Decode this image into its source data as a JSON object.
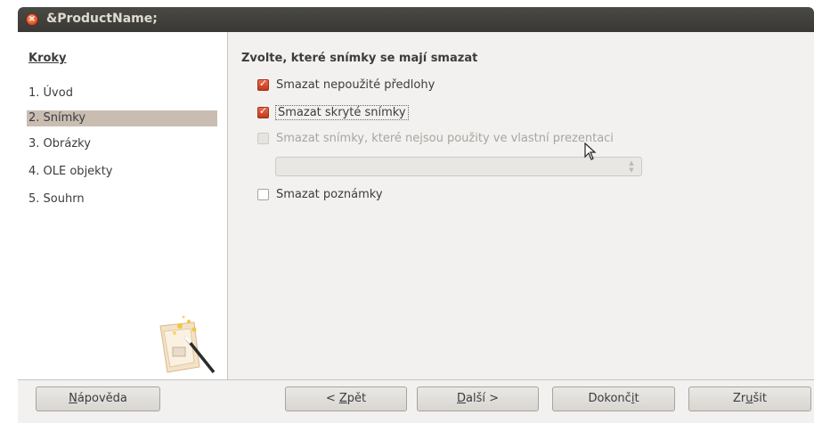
{
  "window": {
    "title": "&ProductName;"
  },
  "sidebar": {
    "heading": "Kroky",
    "steps": [
      {
        "label": "1. Úvod",
        "active": false
      },
      {
        "label": "2. Snímky",
        "active": true
      },
      {
        "label": "3. Obrázky",
        "active": false
      },
      {
        "label": "4. OLE objekty",
        "active": false
      },
      {
        "label": "5. Souhrn",
        "active": false
      }
    ]
  },
  "content": {
    "heading": "Zvolte, které snímky se mají smazat",
    "options": [
      {
        "label": "Smazat nepoužité předlohy",
        "checked": true,
        "disabled": false
      },
      {
        "label": "Smazat skryté snímky",
        "checked": true,
        "disabled": false
      },
      {
        "label": "Smazat snímky, které nejsou použity ve vlastní prezentaci",
        "checked": false,
        "disabled": true
      },
      {
        "label": "Smazat poznámky",
        "checked": false,
        "disabled": false
      }
    ],
    "custom_show_select": {
      "value": ""
    }
  },
  "footer": {
    "help": {
      "pre": "",
      "mn": "N",
      "post": "ápověda"
    },
    "back": {
      "pre": "< ",
      "mn": "Z",
      "post": "pět"
    },
    "next": {
      "pre": "",
      "mn": "D",
      "post": "alší >"
    },
    "finish": {
      "pre": "Dokonč",
      "mn": "i",
      "post": "t"
    },
    "cancel": {
      "pre": "Zr",
      "mn": "u",
      "post": "šit"
    }
  }
}
